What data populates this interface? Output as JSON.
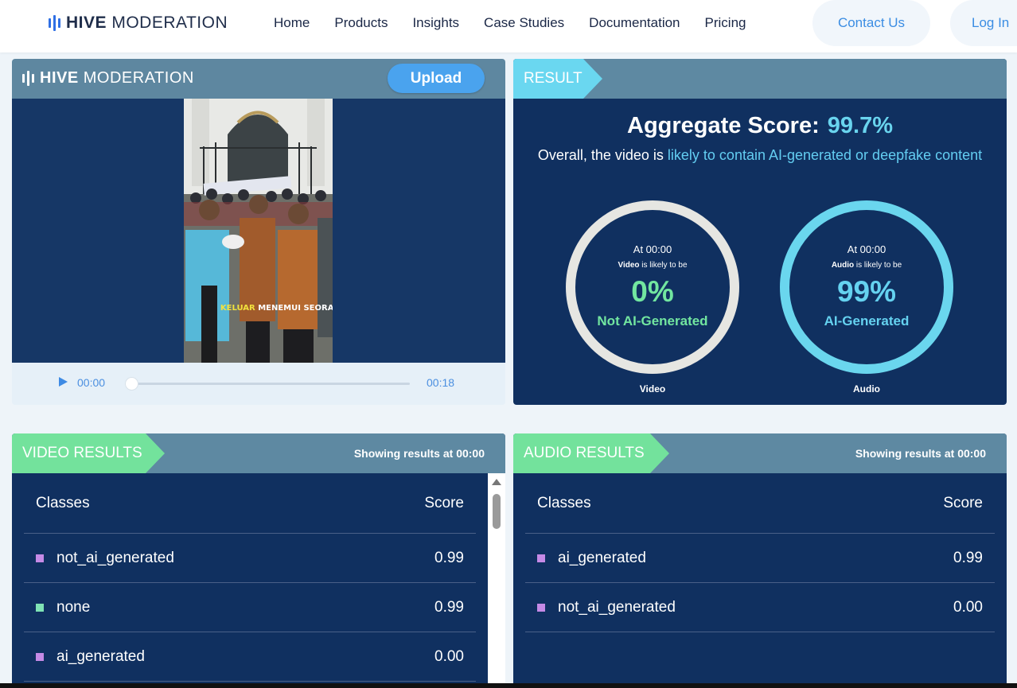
{
  "nav": {
    "logo": {
      "bold": "HIVE",
      "light": " MODERATION",
      "icon": "hive-bars-icon"
    },
    "menu": [
      "Home",
      "Products",
      "Insights",
      "Case Studies",
      "Documentation",
      "Pricing"
    ],
    "contact_label": "Contact Us",
    "login_label": "Log In"
  },
  "player": {
    "logo": {
      "bold": "HIVE",
      "light": " MODERATION"
    },
    "upload_label": "Upload",
    "caption": {
      "highlight": "KELUAR",
      "rest": " MENEMUI SEORANG"
    },
    "time_start": "00:00",
    "time_end": "00:18",
    "progress": 0
  },
  "result": {
    "tag": "RESULT",
    "aggregate_label": "Aggregate Score:",
    "aggregate_value": "99.7%",
    "summary_prefix": "Overall, the video is ",
    "summary_highlight": "likely to contain AI-generated or deepfake content",
    "video": {
      "at": "At 00:00",
      "subject": "Video",
      "likely": " is likely to be",
      "pct": "0%",
      "label": "Not AI-Generated",
      "caption": "Video"
    },
    "audio": {
      "at": "At 00:00",
      "subject": "Audio",
      "likely": " is likely to be",
      "pct": "99%",
      "label": "AI-Generated",
      "caption": "Audio"
    }
  },
  "video_results": {
    "tag": "VIDEO RESULTS",
    "showing_prefix": "Showing results at ",
    "showing_time": "00:00",
    "col_classes": "Classes",
    "col_score": "Score",
    "rows": [
      {
        "cls": "not_ai_generated",
        "score": "0.99"
      },
      {
        "cls": "none",
        "score": "0.99"
      },
      {
        "cls": "ai_generated",
        "score": "0.00"
      }
    ]
  },
  "audio_results": {
    "tag": "AUDIO RESULTS",
    "showing_prefix": "Showing results at ",
    "showing_time": "00:00",
    "col_classes": "Classes",
    "col_score": "Score",
    "rows": [
      {
        "cls": "ai_generated",
        "score": "0.99"
      },
      {
        "cls": "not_ai_generated",
        "score": "0.00"
      }
    ]
  },
  "colors": {
    "purple_class": "#c58ae6",
    "green_class": "#7fe3b5",
    "accent_blue": "#3b8de3",
    "cyan": "#6ad6ee",
    "green": "#73e29c"
  }
}
